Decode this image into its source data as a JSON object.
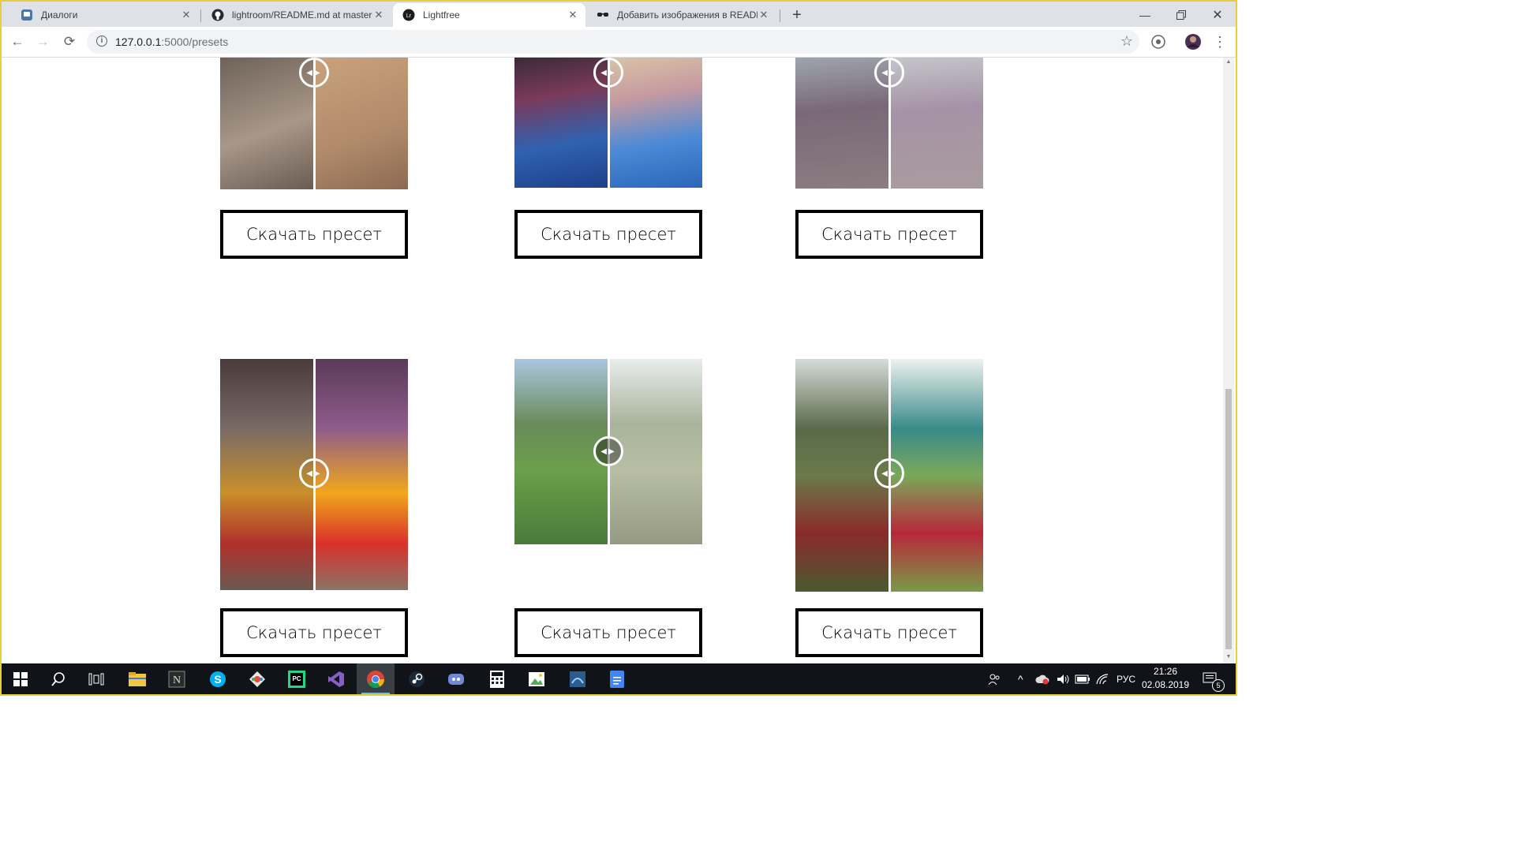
{
  "browser": {
    "tabs": [
      {
        "title": "Диалоги",
        "icon": "vk-chat-icon"
      },
      {
        "title": "lightroom/README.md at master",
        "icon": "github-icon"
      },
      {
        "title": "Lightfree",
        "icon": "lightroom-icon",
        "active": true
      },
      {
        "title": "Добавить изображения в README",
        "icon": "sunglasses-icon"
      }
    ],
    "url_host": "127.0.0.1",
    "url_rest": ":5000/presets"
  },
  "presets": [
    {
      "button_label": "Скачать пресет",
      "left_color": "#9c8a78",
      "right_color": "#b49a7e"
    },
    {
      "button_label": "Скачать пресет",
      "left_color": "#2f5fa8",
      "right_color": "#4b83cf"
    },
    {
      "button_label": "Скачать пресет",
      "left_color": "#8a8490",
      "right_color": "#a8a2aa"
    },
    {
      "button_label": "Скачать пресет",
      "left_color": "#8a6f62",
      "right_color": "#b88a6a"
    },
    {
      "button_label": "Скачать пресет",
      "left_color": "#7c8f5c",
      "right_color": "#b4bb9e"
    },
    {
      "button_label": "Скачать пресет",
      "left_color": "#6f7e5a",
      "right_color": "#8aa567"
    }
  ],
  "taskbar": {
    "language": "РУС",
    "time": "21:26",
    "date": "02.08.2019",
    "notifications": "5"
  }
}
